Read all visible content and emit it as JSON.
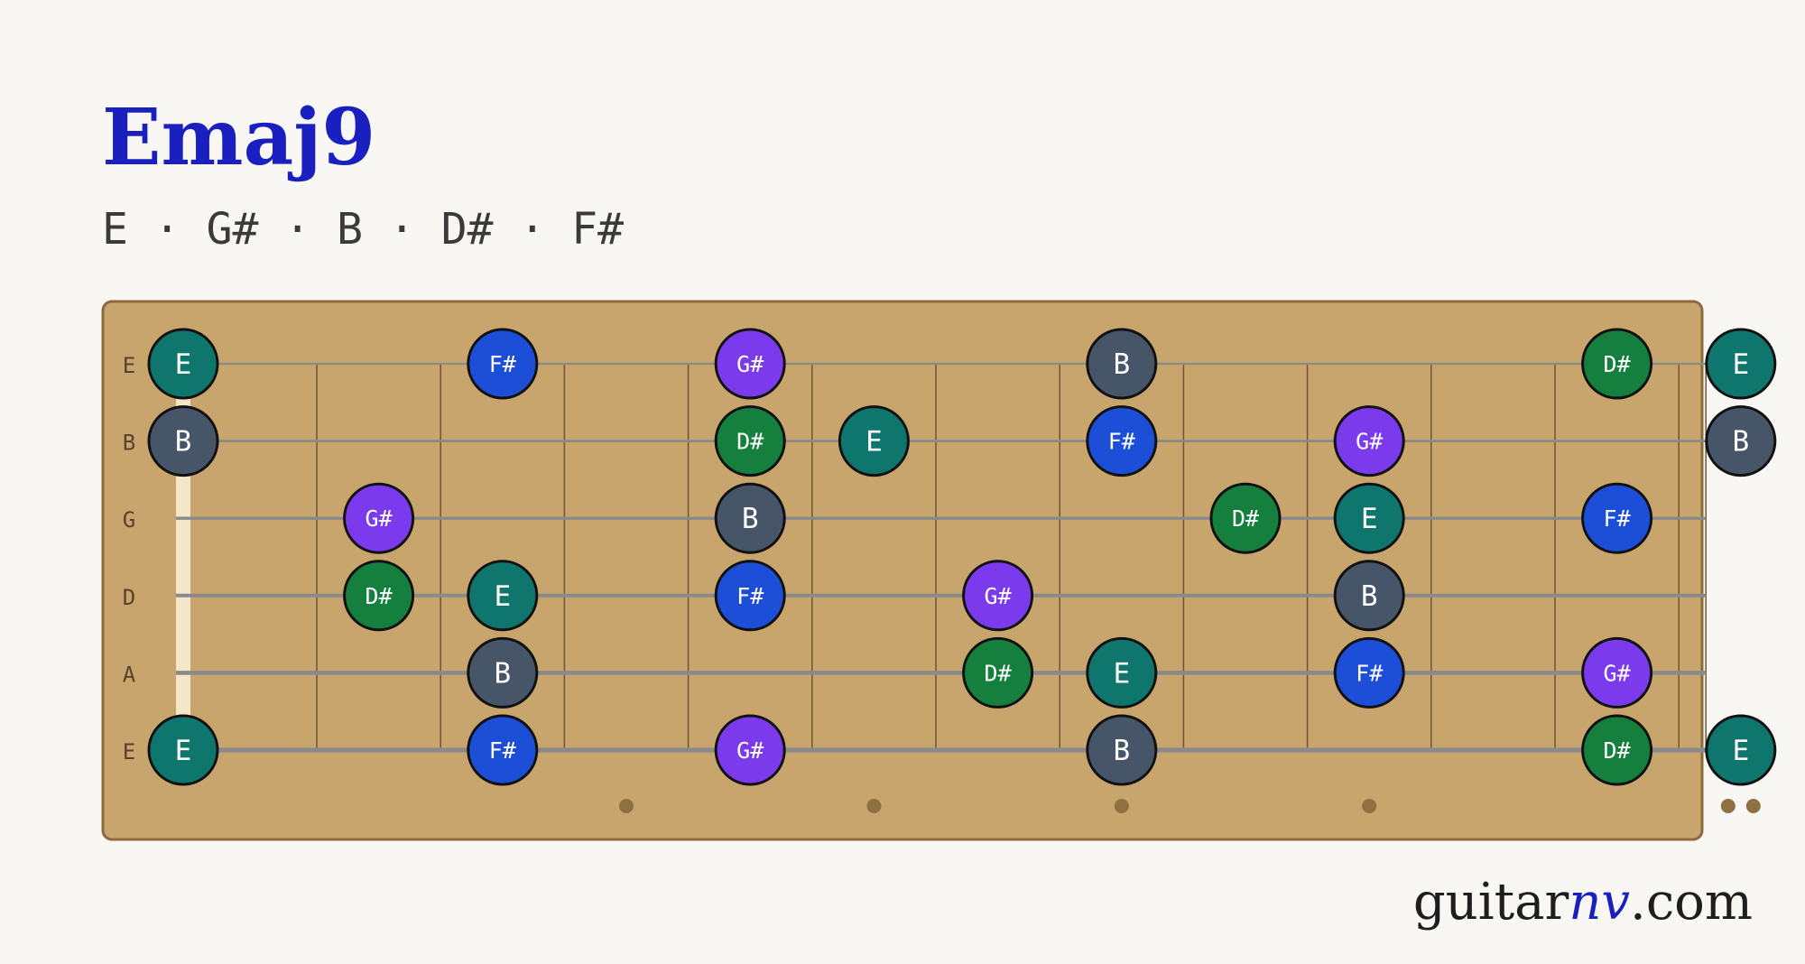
{
  "chord": {
    "name": "Emaj9",
    "notes": [
      "E",
      "G#",
      "B",
      "D#",
      "F#"
    ],
    "separator": " · "
  },
  "brand": {
    "prefix": "guitar",
    "accent": "nv",
    "suffix": ".com"
  },
  "colors": {
    "title": "#1a1fc0",
    "board": "#c8a56d",
    "board_border": "#8a6a3a",
    "fret": "#6e5433",
    "string": "#8a8a8a",
    "nut": "#f4e6c8",
    "marker": "#8f7040",
    "E": "#0f766e",
    "G#": "#7c3aed",
    "B": "#475569",
    "D#": "#15803d",
    "F#": "#1d4ed8"
  },
  "fretboard": {
    "frets": 12,
    "strings": [
      "E",
      "B",
      "G",
      "D",
      "A",
      "E"
    ],
    "inlays": [
      3,
      5,
      7,
      9
    ],
    "double_inlays": [
      12
    ],
    "positions": [
      {
        "string": 0,
        "fret": 0,
        "note": "E"
      },
      {
        "string": 0,
        "fret": 2,
        "note": "F#"
      },
      {
        "string": 0,
        "fret": 4,
        "note": "G#"
      },
      {
        "string": 0,
        "fret": 7,
        "note": "B"
      },
      {
        "string": 0,
        "fret": 11,
        "note": "D#"
      },
      {
        "string": 0,
        "fret": 12,
        "note": "E"
      },
      {
        "string": 1,
        "fret": 0,
        "note": "B"
      },
      {
        "string": 1,
        "fret": 4,
        "note": "D#"
      },
      {
        "string": 1,
        "fret": 5,
        "note": "E"
      },
      {
        "string": 1,
        "fret": 7,
        "note": "F#"
      },
      {
        "string": 1,
        "fret": 9,
        "note": "G#"
      },
      {
        "string": 1,
        "fret": 12,
        "note": "B"
      },
      {
        "string": 2,
        "fret": 1,
        "note": "G#"
      },
      {
        "string": 2,
        "fret": 4,
        "note": "B"
      },
      {
        "string": 2,
        "fret": 8,
        "note": "D#"
      },
      {
        "string": 2,
        "fret": 9,
        "note": "E"
      },
      {
        "string": 2,
        "fret": 11,
        "note": "F#"
      },
      {
        "string": 3,
        "fret": 1,
        "note": "D#"
      },
      {
        "string": 3,
        "fret": 2,
        "note": "E"
      },
      {
        "string": 3,
        "fret": 4,
        "note": "F#"
      },
      {
        "string": 3,
        "fret": 6,
        "note": "G#"
      },
      {
        "string": 3,
        "fret": 9,
        "note": "B"
      },
      {
        "string": 4,
        "fret": 2,
        "note": "B"
      },
      {
        "string": 4,
        "fret": 6,
        "note": "D#"
      },
      {
        "string": 4,
        "fret": 7,
        "note": "E"
      },
      {
        "string": 4,
        "fret": 9,
        "note": "F#"
      },
      {
        "string": 4,
        "fret": 11,
        "note": "G#"
      },
      {
        "string": 5,
        "fret": 0,
        "note": "E"
      },
      {
        "string": 5,
        "fret": 2,
        "note": "F#"
      },
      {
        "string": 5,
        "fret": 4,
        "note": "G#"
      },
      {
        "string": 5,
        "fret": 7,
        "note": "B"
      },
      {
        "string": 5,
        "fret": 11,
        "note": "D#"
      },
      {
        "string": 5,
        "fret": 12,
        "note": "E"
      }
    ]
  }
}
